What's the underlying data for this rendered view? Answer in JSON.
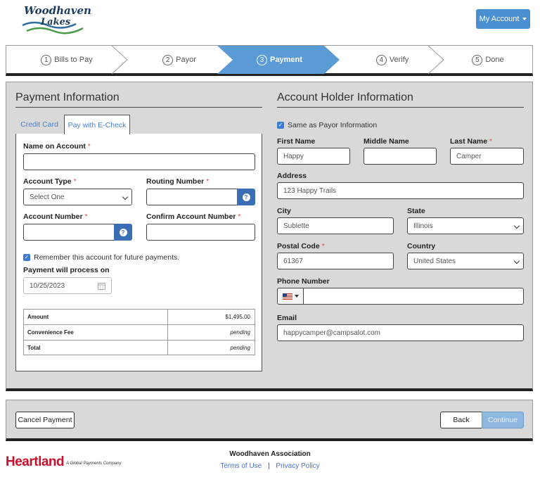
{
  "brand": {
    "logo_text_top": "Woodhaven",
    "logo_text_bottom": "Lakes"
  },
  "header": {
    "account_button": "My Account"
  },
  "steps": [
    {
      "num": "1",
      "label": "Bills to Pay"
    },
    {
      "num": "2",
      "label": "Payor"
    },
    {
      "num": "3",
      "label": "Payment",
      "active": true
    },
    {
      "num": "4",
      "label": "Verify"
    },
    {
      "num": "5",
      "label": "Done"
    }
  ],
  "payment": {
    "title": "Payment Information",
    "tabs": {
      "credit_card": "Credit Card",
      "echeck": "Pay with E-Check"
    },
    "name_label": "Name on Account",
    "account_type_label": "Account Type",
    "account_type_value": "Select One",
    "routing_label": "Routing Number",
    "account_number_label": "Account Number",
    "confirm_label": "Confirm Account Number",
    "remember_label": "Remember this account for future payments.",
    "process_label": "Payment will process on",
    "process_date": "10/25/2023",
    "summary": [
      {
        "label": "Amount",
        "value": "$1,495.00",
        "italic": false
      },
      {
        "label": "Convenience Fee",
        "value": "pending",
        "italic": true
      },
      {
        "label": "Total",
        "value": "pending",
        "italic": true
      }
    ]
  },
  "holder": {
    "title": "Account Holder Information",
    "same_as_label": "Same as Payor Information",
    "first_name_label": "First Name",
    "first_name": "Happy",
    "middle_name_label": "Middle Name",
    "middle_name": "",
    "last_name_label": "Last Name",
    "last_name": "Camper",
    "address_label": "Address",
    "address": "123 Happy Trails",
    "city_label": "City",
    "city": "Sublette",
    "state_label": "State",
    "state": "Illinois",
    "postal_label": "Postal Code",
    "postal": "61367",
    "country_label": "Country",
    "country": "United States",
    "phone_label": "Phone Number",
    "phone": "",
    "email_label": "Email",
    "email": "happycamper@campsalot.com"
  },
  "actions": {
    "cancel": "Cancel Payment",
    "back": "Back",
    "continue": "Continue"
  },
  "footer": {
    "heartland": "Heartland",
    "tagline": "A Global Payments Company",
    "org": "Woodhaven Association",
    "terms": "Terms of Use",
    "separator": "|",
    "privacy": "Privacy Policy"
  },
  "colors": {
    "accent": "#5b9bd5",
    "primary": "#4a90d0",
    "required": "#e05050",
    "heartland_red": "#c8102e"
  }
}
